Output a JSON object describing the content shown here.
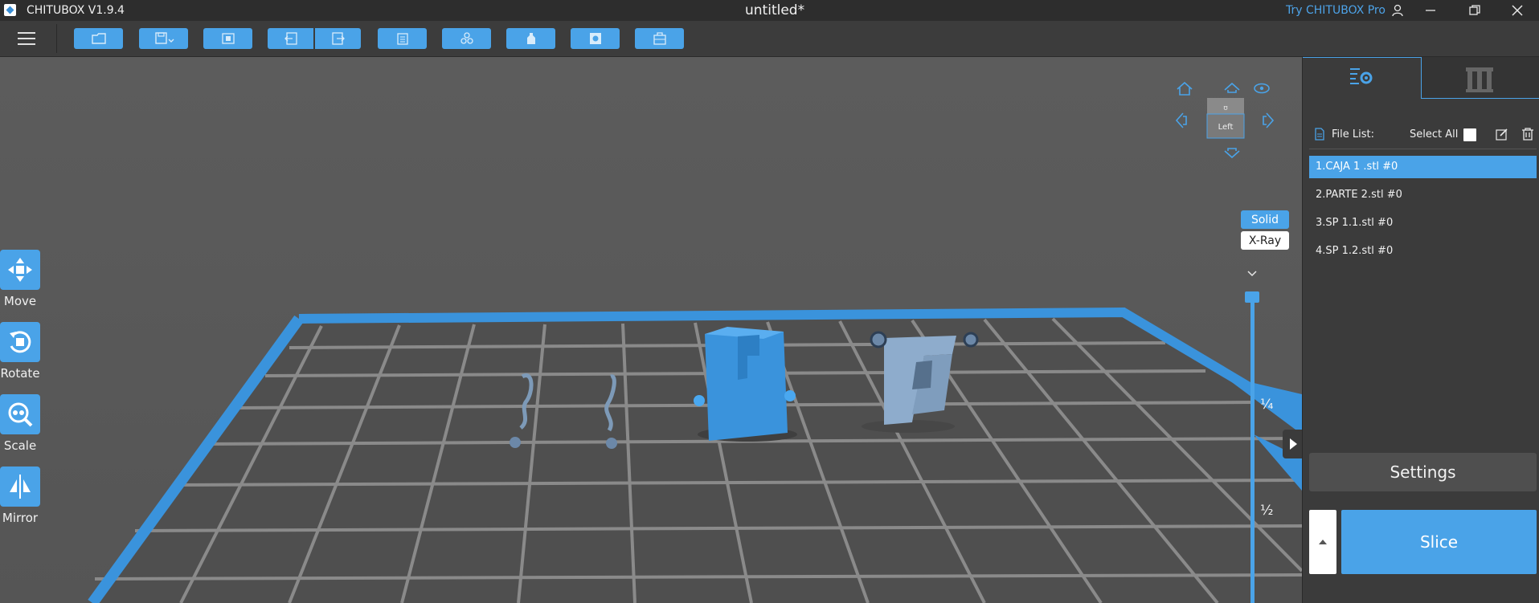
{
  "app": {
    "title": "CHITUBOX V1.9.4",
    "document_title": "untitled*",
    "try_pro": "Try CHITUBOX Pro"
  },
  "toolbar": {
    "buttons": [
      {
        "name": "open-file",
        "icon": "folder-icon"
      },
      {
        "name": "save",
        "icon": "save-icon"
      },
      {
        "name": "layout",
        "icon": "auto-layout-icon"
      },
      {
        "name": "undo",
        "icon": "undo-icon"
      },
      {
        "name": "redo",
        "icon": "redo-icon"
      },
      {
        "name": "paste",
        "icon": "clipboard-icon"
      },
      {
        "name": "supports",
        "icon": "supports-icon"
      },
      {
        "name": "hollow",
        "icon": "hollow-icon"
      },
      {
        "name": "dig-hole",
        "icon": "hole-icon"
      },
      {
        "name": "settings-box",
        "icon": "box-icon"
      }
    ]
  },
  "tools": {
    "move": "Move",
    "rotate": "Rotate",
    "scale": "Scale",
    "mirror": "Mirror"
  },
  "view_cube": {
    "face_label": "Left"
  },
  "render_mode": {
    "solid": "Solid",
    "xray": "X-Ray"
  },
  "layer_slider": {
    "mark_quarter": "¼",
    "mark_half": "½"
  },
  "panel": {
    "file_list_label": "File List:",
    "select_all": "Select All",
    "files": [
      {
        "label": "1.CAJA 1 .stl #0",
        "selected": true
      },
      {
        "label": "2.PARTE 2.stl #0",
        "selected": false
      },
      {
        "label": "3.SP 1.1.stl #0",
        "selected": false
      },
      {
        "label": "4.SP 1.2.stl #0",
        "selected": false
      }
    ],
    "settings_label": "Settings",
    "slice_label": "Slice"
  },
  "colors": {
    "accent": "#4aa3e8",
    "model": "#3a93dc",
    "background": "#5a5a5a",
    "panel": "#3b3b3b",
    "titlebar": "#2d2d2d"
  }
}
